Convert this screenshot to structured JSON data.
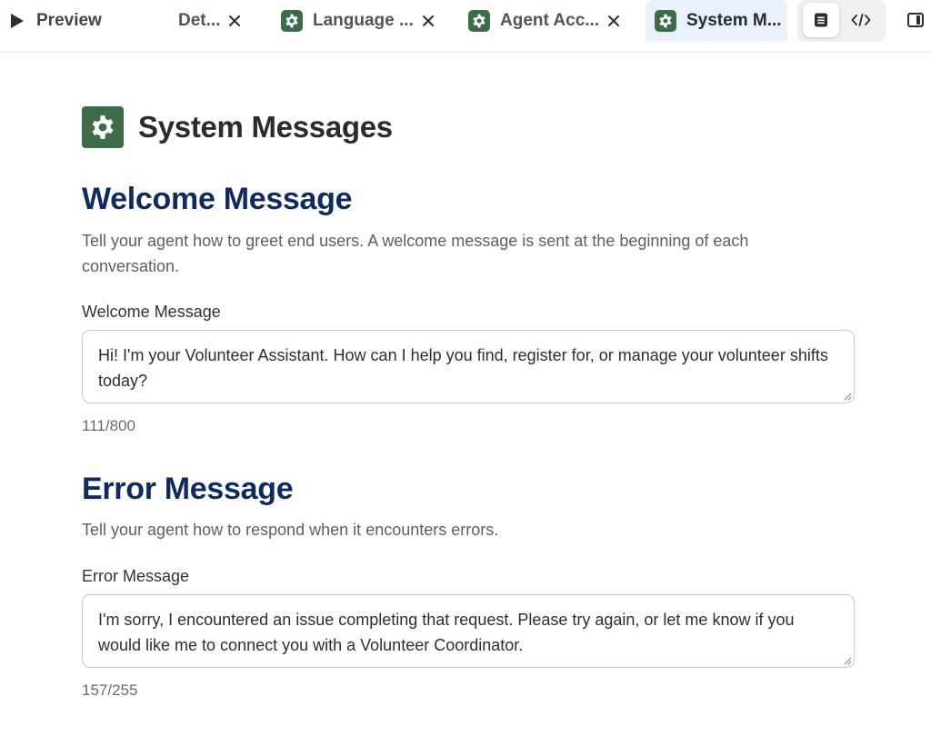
{
  "tabs": {
    "preview_label": "Preview",
    "items": [
      {
        "label": "Det...",
        "has_icon": false
      },
      {
        "label": "Language ...",
        "has_icon": true
      },
      {
        "label": "Agent Acc...",
        "has_icon": true
      },
      {
        "label": "System M...",
        "has_icon": true,
        "active": true
      }
    ]
  },
  "view_toggle": {
    "options": [
      "document-view-icon",
      "code-view-icon"
    ],
    "selected": "document-view-icon"
  },
  "page": {
    "title": "System Messages",
    "icon": "gear-icon"
  },
  "welcome": {
    "title": "Welcome Message",
    "description": "Tell your agent how to greet end users. A welcome message is sent at the beginning of each conversation.",
    "field_label": "Welcome Message",
    "value": "Hi! I'm your Volunteer Assistant. How can I help you find, register for, or manage your volunteer shifts today?",
    "counter": "111/800"
  },
  "error": {
    "title": "Error Message",
    "description": "Tell your agent how to respond when it encounters errors.",
    "field_label": "Error Message",
    "value": "I'm sorry, I encountered an issue completing that request. Please try again, or let me know if you would like me to connect you with a Volunteer Coordinator.",
    "counter": "157/255"
  },
  "colors": {
    "accent_green": "#3e6b4a",
    "heading_navy": "#0f2a5e",
    "active_tab_bg": "#e9f1fd"
  }
}
